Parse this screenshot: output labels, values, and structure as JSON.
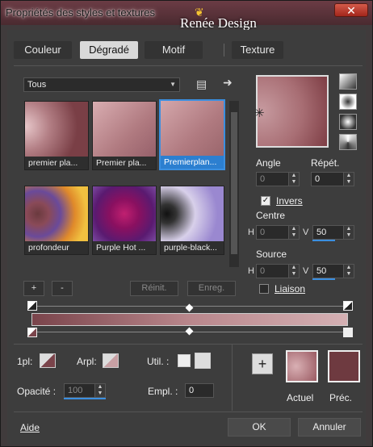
{
  "window": {
    "title": "Propriétés des styles et textures",
    "watermark": "Renée Design",
    "close_glyph": "✕"
  },
  "tabs": [
    {
      "label": "Couleur",
      "active": false
    },
    {
      "label": "Dégradé",
      "active": true
    },
    {
      "label": "Motif",
      "active": false
    },
    {
      "label": "Texture",
      "active": false
    }
  ],
  "library": {
    "category": "Tous",
    "thumbnails": [
      {
        "label": "premier pla...",
        "selected": false
      },
      {
        "label": "Premier pla...",
        "selected": false
      },
      {
        "label": "Premierplan...",
        "selected": true
      },
      {
        "label": "profondeur",
        "selected": false
      },
      {
        "label": "Purple Hot ...",
        "selected": false
      },
      {
        "label": "purple-black...",
        "selected": false
      }
    ],
    "add_label": "+",
    "remove_label": "-",
    "reset_label": "Réinit.",
    "save_label": "Enreg."
  },
  "properties": {
    "angle_label": "Angle",
    "angle_value": "0",
    "repeat_label": "Répét.",
    "repeat_value": "0",
    "invert_label": "Invers",
    "invert_checked": true,
    "center_label": "Centre",
    "center_h": "0",
    "center_v": "50",
    "source_label": "Source",
    "source_h": "0",
    "source_v": "50",
    "link_label": "Liaison",
    "link_checked": false,
    "h_label": "H",
    "v_label": "V"
  },
  "gradient_editor": {
    "fg_label": "1pl:",
    "bg_label": "Arpl:",
    "use_label": "Util. :",
    "opacity_label": "Opacité :",
    "opacity_value": "100",
    "location_label": "Empl. :",
    "location_value": "0",
    "add_glyph": "+"
  },
  "swatches": {
    "current_label": "Actuel",
    "previous_label": "Préc.",
    "current_color": "#b07880",
    "previous_color": "#6e3a40"
  },
  "footer": {
    "help_label": "Aide",
    "ok_label": "OK",
    "cancel_label": "Annuler"
  },
  "colors": {
    "accent": "#3b8fe0",
    "gradient_start": "#7a444b",
    "gradient_end": "#d4b0b3"
  }
}
